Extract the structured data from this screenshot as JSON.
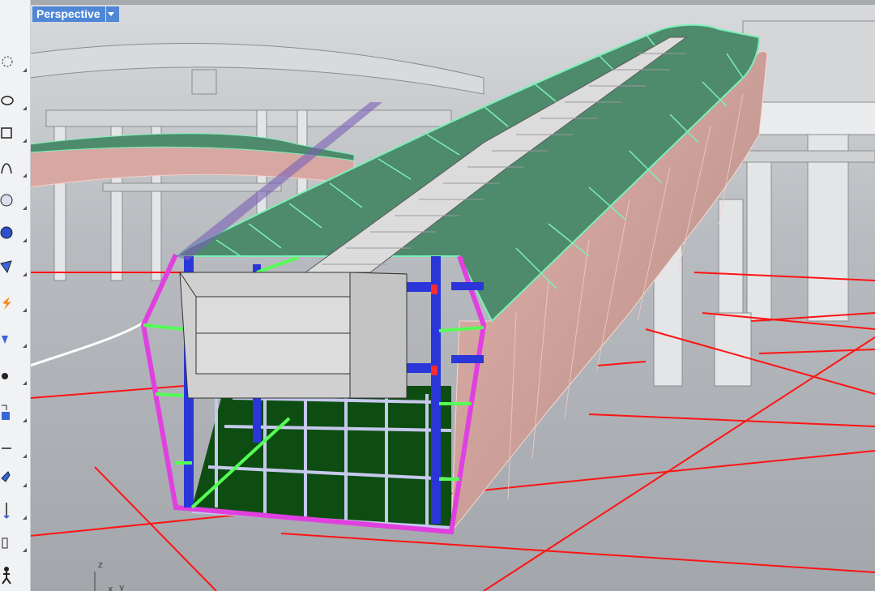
{
  "viewport": {
    "title": "Perspective",
    "dropdown_icon": "chevron-down-icon"
  },
  "axis": {
    "z": "z",
    "x": "x",
    "y": "y"
  },
  "toolbar": {
    "tools": [
      "lasso-select-icon",
      "ellipse-icon",
      "rectangle-icon",
      "curve-icon",
      "sphere-icon",
      "solid-sphere-icon",
      "surface-icon",
      "flash-icon",
      "extrude-icon",
      "point-icon",
      "transform-icon",
      "dimension-icon",
      "arrow-icon",
      "move-icon",
      "properties-icon",
      "walk-icon"
    ]
  },
  "colors": {
    "background": "#a6a9ae",
    "tab": "#4f87d6",
    "roof": "#4e8a6c",
    "roof_edge": "#7cf0b8",
    "side_wall": "#d8a7a0",
    "frame_magenta": "#e040e0",
    "column_blue": "#2a36d8",
    "floor": "#0d4d12",
    "grid_red": "#ff0000"
  }
}
